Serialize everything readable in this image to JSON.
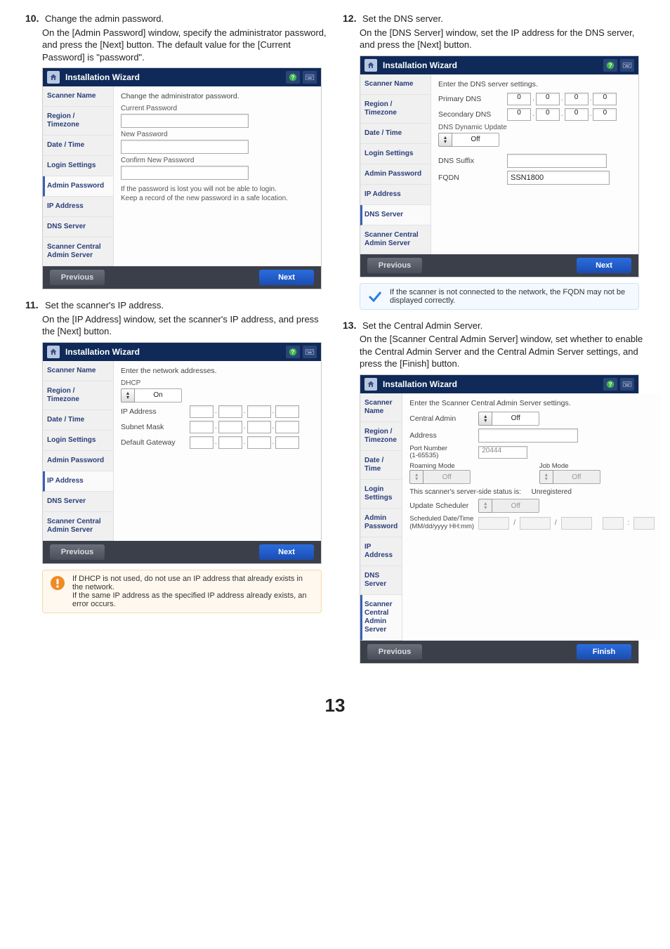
{
  "pageNumber": "13",
  "wizardTitle": "Installation Wizard",
  "nav": {
    "scannerName": "Scanner Name",
    "regionTimezone": "Region / Timezone",
    "dateTime": "Date / Time",
    "loginSettings": "Login Settings",
    "adminPassword": "Admin Password",
    "ipAddress": "IP Address",
    "dnsServer": "DNS Server",
    "scannerCentral": "Scanner Central Admin Server"
  },
  "buttons": {
    "previous": "Previous",
    "next": "Next",
    "finish": "Finish"
  },
  "step10": {
    "num": "10.",
    "title": "Change the admin password.",
    "body": "On the [Admin Password] window, specify the administrator password, and press the [Next] button. The default value for the [Current Password] is \"password\".",
    "pane": {
      "desc": "Change the administrator password.",
      "currentPwd": "Current Password",
      "newPwd": "New Password",
      "confirmPwd": "Confirm New Password",
      "note1": "If the password is lost you will not be able to login.",
      "note2": "Keep a record of the new password in a safe location."
    }
  },
  "step11": {
    "num": "11.",
    "title": "Set the scanner's IP address.",
    "body": "On the [IP Address] window, set the scanner's IP address, and press the [Next] button.",
    "pane": {
      "desc": "Enter the network addresses.",
      "dhcpLabel": "DHCP",
      "dhcpValue": "On",
      "ipLabel": "IP Address",
      "subnetLabel": "Subnet Mask",
      "gatewayLabel": "Default Gateway"
    },
    "callout": "If DHCP is not used, do not use an IP address that already exists in the network.\nIf the same IP address as the specified IP address already exists, an error occurs."
  },
  "step12": {
    "num": "12.",
    "title": "Set the DNS server.",
    "body": "On the [DNS Server] window, set the IP address for the DNS server, and press the [Next] button.",
    "pane": {
      "desc": "Enter the DNS server settings.",
      "primary": "Primary DNS",
      "secondary": "Secondary DNS",
      "dynUpdate": "DNS Dynamic Update",
      "dynValue": "Off",
      "suffix": "DNS Suffix",
      "fqdnLabel": "FQDN",
      "fqdnValue": "SSN1800",
      "ipZero": "0"
    },
    "callout": "If the scanner is not connected to the network, the FQDN may not be displayed correctly."
  },
  "step13": {
    "num": "13.",
    "title": "Set the Central Admin Server.",
    "body": "On the [Scanner Central Admin Server] window, set whether to enable the Central Admin Server and the Central Admin Server settings, and press the [Finish] button.",
    "pane": {
      "desc": "Enter the Scanner Central Admin Server settings.",
      "centralAdmin": "Central Admin",
      "off": "Off",
      "address": "Address",
      "portLabel": "Port Number",
      "portRange": "(1-65535)",
      "portValue": "20444",
      "roaming": "Roaming Mode",
      "jobMode": "Job Mode",
      "statusLabel": "This scanner's server-side status is:",
      "statusValue": "Unregistered",
      "updateSched": "Update Scheduler",
      "schedLabel": "Scheduled Date/Time",
      "schedFmt": "(MM/dd/yyyy HH:mm)",
      "slash": "/",
      "colon": ":"
    }
  }
}
